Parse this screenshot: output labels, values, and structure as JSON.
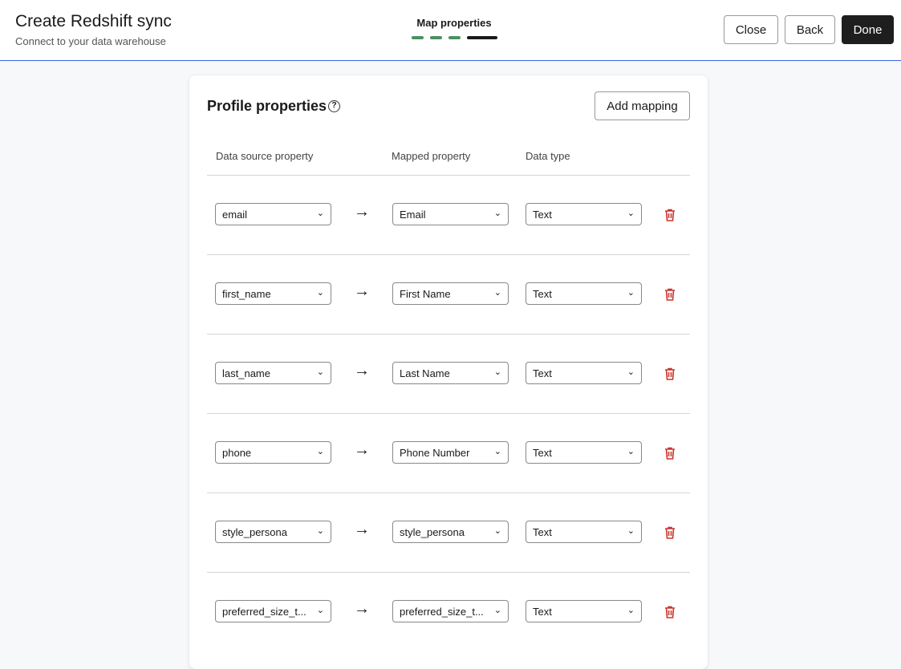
{
  "header": {
    "title": "Create Redshift sync",
    "subtitle": "Connect to your data warehouse",
    "step_label": "Map properties",
    "steps_completed": 3,
    "steps_total": 4,
    "close": "Close",
    "back": "Back",
    "done": "Done"
  },
  "card": {
    "title": "Profile properties",
    "add_mapping": "Add mapping",
    "columns": [
      "Data source property",
      "Mapped property",
      "Data type"
    ],
    "rows": [
      {
        "source": "email",
        "mapped": "Email",
        "type": "Text"
      },
      {
        "source": "first_name",
        "mapped": "First Name",
        "type": "Text"
      },
      {
        "source": "last_name",
        "mapped": "Last Name",
        "type": "Text"
      },
      {
        "source": "phone",
        "mapped": "Phone Number",
        "type": "Text"
      },
      {
        "source": "style_persona",
        "mapped": "style_persona",
        "type": "Text"
      },
      {
        "source": "preferred_size_t...",
        "mapped": "preferred_size_t...",
        "type": "Text"
      }
    ]
  }
}
